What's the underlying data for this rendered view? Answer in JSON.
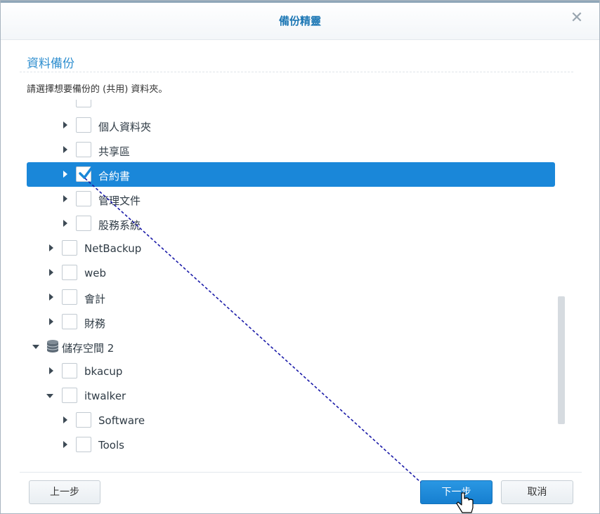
{
  "window": {
    "title": "備份精靈",
    "close_glyph": "✕"
  },
  "section": {
    "heading": "資料備份",
    "instruction": "請選擇想要備份的 (共用) 資料夾。"
  },
  "tree": {
    "rows": [
      {
        "label": "個人資料夾",
        "checked": false,
        "expanded": false
      },
      {
        "label": "共享區",
        "checked": false,
        "expanded": false
      },
      {
        "label": "合約書",
        "checked": true,
        "expanded": false,
        "selected": true
      },
      {
        "label": "管理文件",
        "checked": false,
        "expanded": false
      },
      {
        "label": "股務系統",
        "checked": false,
        "expanded": false
      },
      {
        "label": "NetBackup",
        "checked": false,
        "expanded": false
      },
      {
        "label": "web",
        "checked": false,
        "expanded": false
      },
      {
        "label": "會計",
        "checked": false,
        "expanded": false
      },
      {
        "label": "財務",
        "checked": false,
        "expanded": false
      },
      {
        "label": "儲存空間 2",
        "icon": "database-icon",
        "expanded": true
      },
      {
        "label": "bkacup",
        "checked": false,
        "expanded": false
      },
      {
        "label": "itwalker",
        "checked": false,
        "expanded": true
      },
      {
        "label": "Software",
        "checked": false,
        "expanded": false
      },
      {
        "label": "Tools",
        "checked": false,
        "expanded": false
      }
    ]
  },
  "footer": {
    "prev_label": "上一步",
    "next_label": "下一步",
    "cancel_label": "取消"
  },
  "colors": {
    "accent": "#1a87d9",
    "heading": "#2e8ecf",
    "annotation": "#1a1aa8"
  }
}
